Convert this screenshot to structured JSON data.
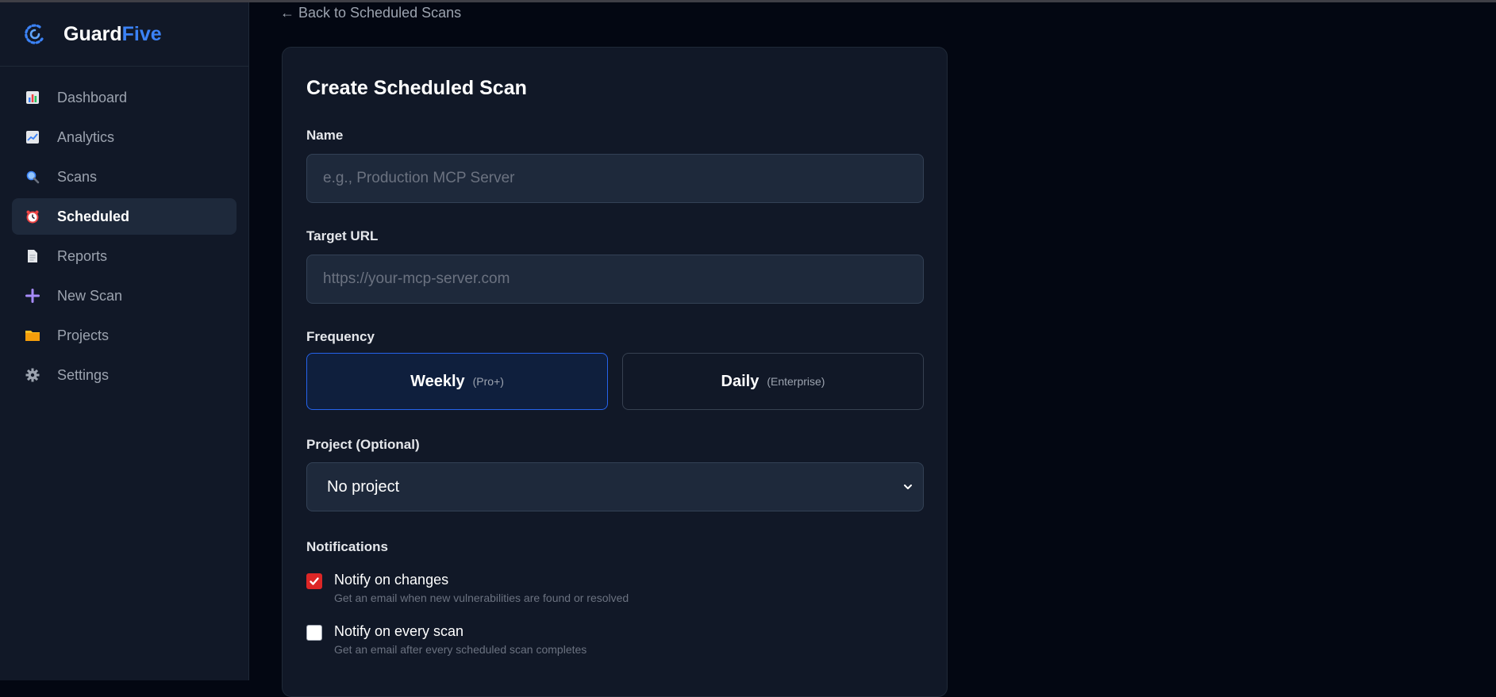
{
  "brand": {
    "name_prefix": "Guard",
    "name_accent": "Five",
    "accent_color": "#3b82f6"
  },
  "sidebar": {
    "items": [
      {
        "label": "Dashboard",
        "icon": "bar-chart-icon",
        "active": false
      },
      {
        "label": "Analytics",
        "icon": "trend-chart-icon",
        "active": false
      },
      {
        "label": "Scans",
        "icon": "magnifier-icon",
        "active": false
      },
      {
        "label": "Scheduled",
        "icon": "alarm-clock-icon",
        "active": true
      },
      {
        "label": "Reports",
        "icon": "document-icon",
        "active": false
      },
      {
        "label": "New Scan",
        "icon": "plus-icon",
        "active": false
      },
      {
        "label": "Projects",
        "icon": "folder-icon",
        "active": false
      },
      {
        "label": "Settings",
        "icon": "gear-icon",
        "active": false
      }
    ]
  },
  "main": {
    "back_link": "← Back to Scheduled Scans",
    "form": {
      "title": "Create Scheduled Scan",
      "name_label": "Name",
      "name_value": "",
      "name_placeholder": "e.g., Production MCP Server",
      "url_label": "Target URL",
      "url_value": "",
      "url_placeholder": "https://your-mcp-server.com",
      "frequency_label": "Frequency",
      "frequency_options": [
        {
          "label": "Weekly",
          "tier": "(Pro+)",
          "selected": true
        },
        {
          "label": "Daily",
          "tier": "(Enterprise)",
          "selected": false
        }
      ],
      "project_label": "Project (Optional)",
      "project_value": "No project",
      "notifications_label": "Notifications",
      "notifications": [
        {
          "title": "Notify on changes",
          "description": "Get an email when new vulnerabilities are found or resolved",
          "checked": true
        },
        {
          "title": "Notify on every scan",
          "description": "Get an email after every scheduled scan completes",
          "checked": false
        }
      ]
    }
  },
  "colors": {
    "selected_border": "#2563eb",
    "checkbox_checked": "#dc2626",
    "background": "#030712",
    "sidebar_bg": "#111827"
  }
}
